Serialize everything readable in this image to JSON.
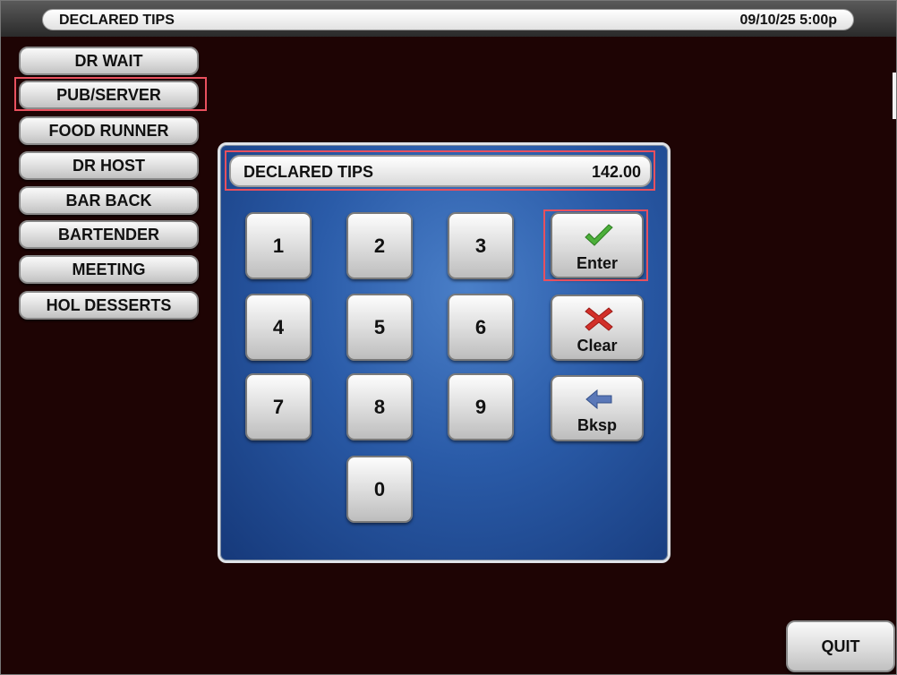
{
  "header": {
    "title": "DECLARED TIPS",
    "datetime": "09/10/25  5:00p"
  },
  "sidebar": {
    "items": [
      {
        "label": "DR WAIT"
      },
      {
        "label": "PUB/SERVER",
        "selected": true
      },
      {
        "label": "FOOD RUNNER"
      },
      {
        "label": "DR HOST"
      },
      {
        "label": "BAR BACK"
      },
      {
        "label": "BARTENDER"
      },
      {
        "label": "MEETING"
      },
      {
        "label": "HOL DESSERTS"
      }
    ]
  },
  "dialog": {
    "display": {
      "label": "DECLARED TIPS",
      "value": "142.00"
    },
    "keypad": [
      "1",
      "2",
      "3",
      "4",
      "5",
      "6",
      "7",
      "8",
      "9",
      "0"
    ],
    "actions": {
      "enter": {
        "label": "Enter",
        "icon": "checkmark-icon"
      },
      "clear": {
        "label": "Clear",
        "icon": "x-icon"
      },
      "backspace": {
        "label": "Bksp",
        "icon": "arrow-left-icon"
      }
    }
  },
  "footer": {
    "quit_label": "QUIT"
  },
  "colors": {
    "background": "#1e0404",
    "dialog_blue": "#2a5ba8",
    "highlight": "#e8505e",
    "enter_icon": "#4caf3a",
    "clear_icon": "#d2302a",
    "bksp_icon": "#5a78b8"
  }
}
